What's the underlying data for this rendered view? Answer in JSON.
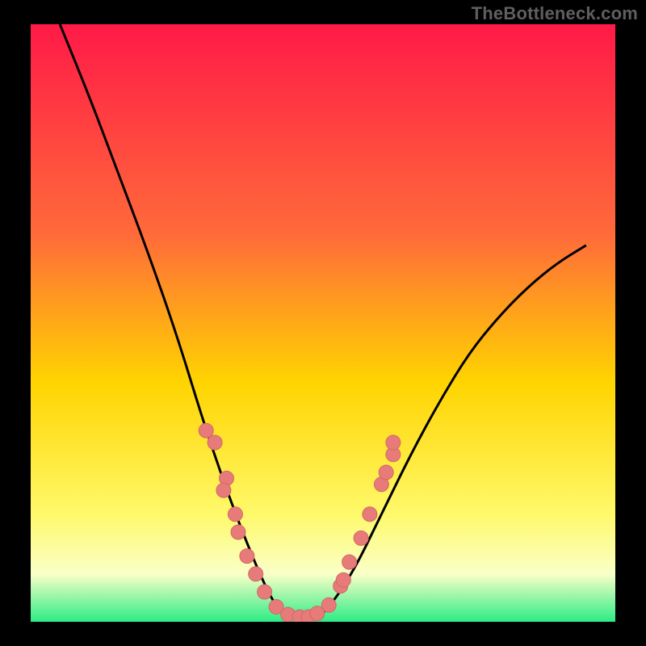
{
  "attribution": "TheBottleneck.com",
  "colors": {
    "black": "#000000",
    "grad_top": "#ff1a47",
    "grad_upper": "#ff6a3a",
    "grad_mid": "#ffd400",
    "grad_lower": "#fff96a",
    "grad_pale": "#faffc8",
    "grad_green": "#2cec85",
    "curve": "#000000",
    "dot_fill": "#e77b7a",
    "dot_stroke": "#d46766"
  },
  "chart_data": {
    "type": "line",
    "title": "",
    "xlabel": "",
    "ylabel": "",
    "xlim": [
      0,
      100
    ],
    "ylim": [
      0,
      100
    ],
    "comment": "Bottleneck curve — x is relative GPU/CPU balance, y is bottleneck %. Curve minimum ~0 around x≈43–50. Values are visually estimated from the plot (no labeled ticks).",
    "series": [
      {
        "name": "bottleneck-curve",
        "x": [
          5,
          10,
          15,
          20,
          25,
          30,
          35,
          40,
          43,
          47,
          50,
          55,
          60,
          65,
          70,
          75,
          80,
          85,
          90,
          95
        ],
        "values": [
          100,
          88,
          75,
          62,
          48,
          32,
          18,
          6,
          1,
          0,
          1,
          8,
          18,
          28,
          37,
          45,
          51,
          56,
          60,
          63
        ]
      }
    ],
    "dots": {
      "name": "sample-cards",
      "comment": "Pink dots clustered on both flanks of the valley and along the floor. Approximate (x, y) pairs in % of plot area, estimated visually.",
      "points": [
        [
          30,
          32
        ],
        [
          31.5,
          30
        ],
        [
          33.5,
          24
        ],
        [
          33,
          22
        ],
        [
          35,
          18
        ],
        [
          35.5,
          15
        ],
        [
          37,
          11
        ],
        [
          38.5,
          8
        ],
        [
          40,
          5
        ],
        [
          42,
          2.5
        ],
        [
          44,
          1.2
        ],
        [
          46,
          0.8
        ],
        [
          47.5,
          0.8
        ],
        [
          49,
          1.4
        ],
        [
          51,
          2.8
        ],
        [
          53,
          6
        ],
        [
          53.5,
          7
        ],
        [
          54.5,
          10
        ],
        [
          56.5,
          14
        ],
        [
          58,
          18
        ],
        [
          60,
          23
        ],
        [
          60.8,
          25
        ],
        [
          62,
          28
        ],
        [
          62,
          30
        ]
      ]
    }
  }
}
